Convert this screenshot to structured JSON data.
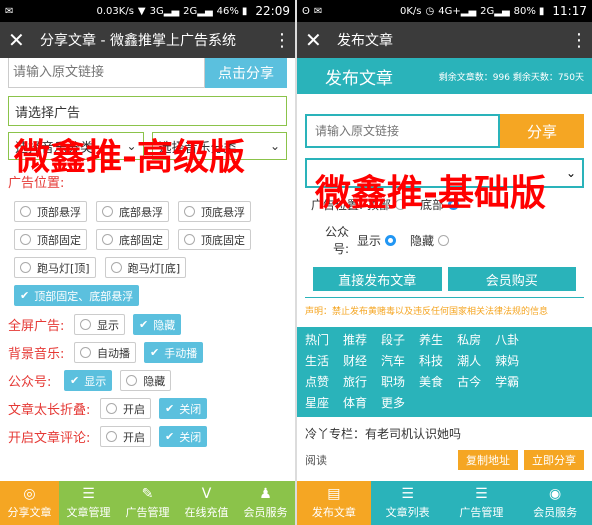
{
  "left": {
    "status": {
      "speed": "0.03K/s",
      "net1": "3G",
      "net2": "2G",
      "battery": "46%",
      "time": "22:09"
    },
    "title": "分享文章 - 微鑫推掌上广告系统",
    "url_placeholder": "请输入原文链接",
    "share_button": "点击分享",
    "ad_select": "请选择广告",
    "music_select_1": "选择音乐分类",
    "music_select_2": "选择音乐分类",
    "watermark": "微鑫推-高级版",
    "ad_position_label": "广告位置:",
    "ad_positions": [
      "顶部悬浮",
      "底部悬浮",
      "顶底悬浮",
      "顶部固定",
      "底部固定",
      "顶底固定",
      "跑马灯[顶]",
      "跑马灯[底]"
    ],
    "ad_position_selected": "顶部固定、底部悬浮",
    "fullscreen_label": "全屏广告:",
    "fullscreen_show": "显示",
    "fullscreen_hide": "隐藏",
    "bgm_label": "背景音乐:",
    "bgm_auto": "自动播",
    "bgm_manual": "手动播",
    "account_label": "公众号:",
    "account_show": "显示",
    "account_hide": "隐藏",
    "fold_label": "文章太长折叠:",
    "fold_on": "开启",
    "fold_off": "关闭",
    "comment_label": "开启文章评论:",
    "comment_on": "开启",
    "comment_off": "关闭",
    "nav": [
      "分享文章",
      "文章管理",
      "广告管理",
      "在线充值",
      "会员服务"
    ]
  },
  "right": {
    "status": {
      "speed": "0K/s",
      "net1": "4G+",
      "net2": "2G",
      "battery": "80%",
      "time": "11:17"
    },
    "title": "发布文章",
    "header_title": "发布文章",
    "stats": "剩余文章数：996  剩余天数：750天",
    "url_placeholder": "请输入原文链接",
    "share_button": "分享",
    "watermark": "微鑫推-基础版",
    "ad_position_label": "广告位置:",
    "ad_top": "顶部",
    "ad_bottom": "底部",
    "account_label": "公众号:",
    "account_show": "显示",
    "account_hide": "隐藏",
    "publish_button": "直接发布文章",
    "member_button": "会员购买",
    "notice": "声明：禁止发布黄赌毒以及违反任何国家相关法律法规的信息",
    "categories": [
      "热门",
      "推荐",
      "段子",
      "养生",
      "私房",
      "八卦",
      "生活",
      "财经",
      "汽车",
      "科技",
      "潮人",
      "辣妈",
      "点赞",
      "旅行",
      "职场",
      "美食",
      "古今",
      "学霸",
      "星座",
      "体育",
      "更多"
    ],
    "column": "冷丫专栏：有老司机认识她吗",
    "read_label": "阅读",
    "copy_button": "复制地址",
    "share_now_button": "立即分享",
    "nav": [
      "发布文章",
      "文章列表",
      "广告管理",
      "会员服务"
    ]
  },
  "colors": {
    "green": "#8bc34a",
    "blue": "#5bc0de",
    "teal": "#2ab3ba",
    "orange": "#f5a623",
    "red": "#e53935"
  }
}
